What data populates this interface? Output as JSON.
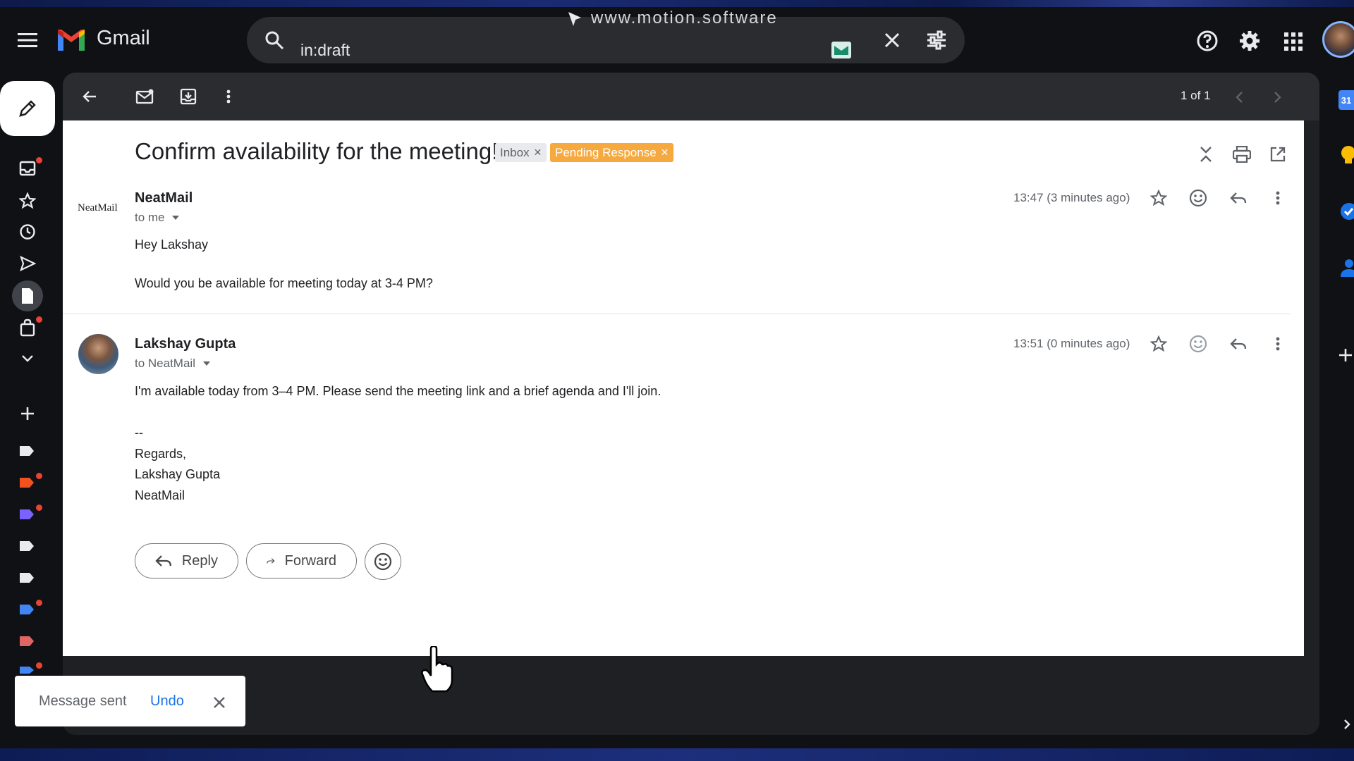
{
  "watermark": "www.motion.software",
  "app": {
    "name": "Gmail"
  },
  "search": {
    "value": "in:draft"
  },
  "toolbar": {
    "pager": "1 of 1"
  },
  "thread": {
    "subject": "Confirm availability for the meeting!",
    "labels": [
      {
        "text": "Inbox",
        "color": "#e8eaed"
      },
      {
        "text": "Pending Response",
        "color": "#f5a93f"
      }
    ],
    "messages": [
      {
        "sender": "NeatMail",
        "logo_text": "NeatMail",
        "recipient": "to me",
        "time": "13:47 (3 minutes ago)",
        "body": [
          "Hey Lakshay",
          "Would you be available for meeting today at 3-4 PM?"
        ]
      },
      {
        "sender": "Lakshay Gupta",
        "recipient": "to NeatMail",
        "time": "13:51 (0 minutes ago)",
        "body": [
          "I'm available today from 3–4 PM. Please send the meeting link and a brief agenda and I'll join."
        ],
        "signature": [
          "--",
          "Regards,",
          "Lakshay Gupta",
          "NeatMail"
        ]
      }
    ],
    "actions": {
      "reply": "Reply",
      "forward": "Forward"
    }
  },
  "calendar_badge": "31",
  "snackbar": {
    "text": "Message sent",
    "action": "Undo"
  },
  "colors": {
    "accent_blue": "#1a73e8",
    "pending_label": "#f5a93f",
    "notification_dot": "#ea4335"
  }
}
